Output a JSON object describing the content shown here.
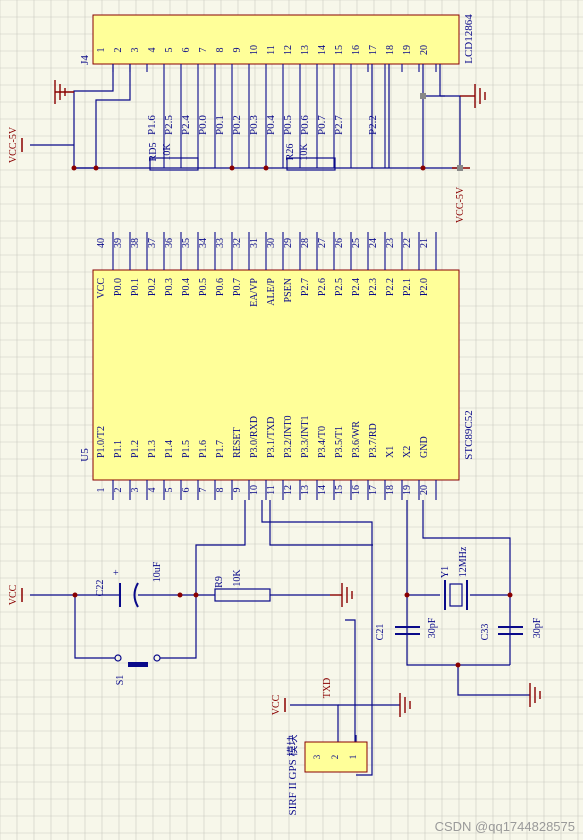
{
  "colors": {
    "wire": "#0a0a8a",
    "label": "#8a0000",
    "chip_fill": "#ffff99",
    "chip_border": "#8a0000",
    "ground": "#8a0000",
    "junction": "#8a0000",
    "grid": "#c9c9bf",
    "background": "#f7f7ea"
  },
  "lcd": {
    "ref": "J4",
    "name": "LCD12864",
    "pin_numbers": [
      "1",
      "2",
      "3",
      "4",
      "5",
      "6",
      "7",
      "8",
      "9",
      "10",
      "11",
      "12",
      "13",
      "14",
      "15",
      "16",
      "17",
      "18",
      "19",
      "20"
    ],
    "pin_labels": [
      "P1.6",
      "P2.5",
      "P2.4",
      "P0.0",
      "P0.1",
      "P0.2",
      "P0.3",
      "P0.4",
      "P0.5",
      "P0.6",
      "P0.7",
      "P2.7",
      "P2.2"
    ],
    "vcc_label": "VCC-5V",
    "vcc_label_2": "VCC-5V"
  },
  "resistors": {
    "r25_ref": "RD5",
    "r25_value": "10K",
    "r26_ref": "R26",
    "r26_value": "10K",
    "r9_ref": "R9",
    "r9_value": "10K"
  },
  "mcu": {
    "ref": "U5",
    "name": "STC89C52",
    "top_pin_numbers": [
      "40",
      "39",
      "38",
      "37",
      "36",
      "35",
      "34",
      "33",
      "32",
      "31",
      "30",
      "29",
      "28",
      "27",
      "26",
      "25",
      "24",
      "23",
      "22",
      "21"
    ],
    "top_pin_names": [
      "VCC",
      "P0.0",
      "P0.1",
      "P0.2",
      "P0.3",
      "P0.4",
      "P0.5",
      "P0.6",
      "P0.7",
      "EA/VP",
      "ALE/P",
      "PSEN",
      "P2.7",
      "P2.6",
      "P2.5",
      "P2.4",
      "P2.3",
      "P2.2",
      "P2.1",
      "P2.0"
    ],
    "bottom_pin_numbers": [
      "1",
      "2",
      "3",
      "4",
      "5",
      "6",
      "7",
      "8",
      "9",
      "10",
      "11",
      "12",
      "13",
      "14",
      "15",
      "16",
      "17",
      "18",
      "19",
      "20"
    ],
    "bottom_pin_names": [
      "P1.0/T2",
      "P1.1",
      "P1.2",
      "P1.3",
      "P1.4",
      "P1.5",
      "P1.6",
      "P1.7",
      "RESET",
      "P3.0/RXD",
      "P3.1/TXD",
      "P3.2/INT0",
      "P3.3/INT1",
      "P3.4/T0",
      "P3.5/T1",
      "P3.6/WR",
      "P3.7/RD",
      "X1",
      "X2",
      "GND"
    ]
  },
  "reset": {
    "vcc_label": "VCC",
    "cap_ref": "C22",
    "cap_value": "10uF",
    "cap_polarity": "+",
    "switch_ref": "S1"
  },
  "crystal": {
    "ref": "Y1",
    "value": "12MHz",
    "c21_ref": "C21",
    "c21_value": "30pF",
    "c33_ref": "C33",
    "c33_value": "30pF"
  },
  "gps": {
    "vcc_label": "VCC",
    "txd_label": "TXD",
    "module_name": "SIRF II GPS 模块",
    "pin_numbers": [
      "3",
      "2",
      "1"
    ]
  },
  "watermark": "CSDN @qq1744828575"
}
